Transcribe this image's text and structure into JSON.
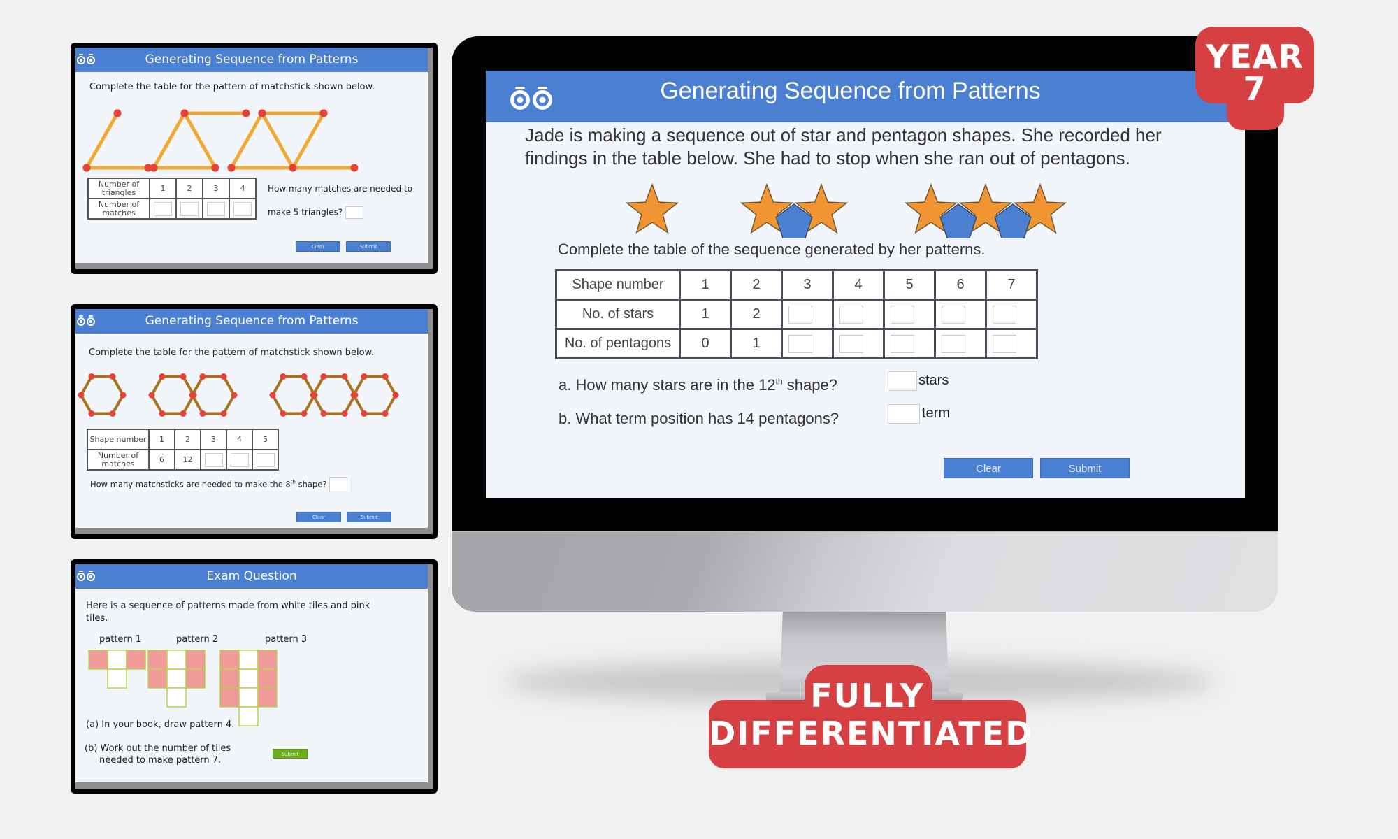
{
  "colors": {
    "background": "#f1f1f1",
    "header_blue": "#4a7fd1",
    "badge_red": "#d64043",
    "matchstick_orange": "#f0a935",
    "matchstick_brown": "#a8731f",
    "joint_red": "#e8413a",
    "star_orange": "#f19532",
    "pentagon_blue": "#4a7fd1",
    "tile_pink": "#f09a99",
    "tile_border": "#b9d24a",
    "submit_green": "#6aae1a"
  },
  "thumbnails": [
    {
      "title": "Generating Sequence from Patterns",
      "instruction": "Complete the table for the pattern of matchstick shown below.",
      "pattern_type": "triangles",
      "pattern_counts": [
        1,
        2,
        3
      ],
      "table": {
        "rows": [
          {
            "label": "Number of triangles",
            "values": [
              "1",
              "2",
              "3",
              "4"
            ]
          },
          {
            "label": "Number of matches",
            "values": [
              "",
              "",
              "",
              ""
            ]
          }
        ]
      },
      "question_line1": "How many matches are needed to",
      "question_line2": "make 5 triangles?",
      "buttons": {
        "clear": "Clear",
        "submit": "Submit"
      }
    },
    {
      "title": "Generating Sequence from Patterns",
      "instruction": "Complete the table for the pattern of matchstick shown below.",
      "pattern_type": "hexagons",
      "pattern_counts": [
        1,
        2,
        3
      ],
      "table": {
        "rows": [
          {
            "label": "Shape number",
            "values": [
              "1",
              "2",
              "3",
              "4",
              "5"
            ]
          },
          {
            "label": "Number of matches",
            "values": [
              "6",
              "12",
              "",
              "",
              ""
            ]
          }
        ]
      },
      "question": "How many matchsticks are needed to make the 8",
      "question_sup": "th",
      "question_end": " shape?",
      "buttons": {
        "clear": "Clear",
        "submit": "Submit"
      }
    },
    {
      "title": "Exam Question",
      "intro_line1": "Here is a sequence of patterns made from white tiles and pink",
      "intro_line2": "tiles.",
      "patterns": [
        {
          "label": "pattern 1",
          "rows": 1
        },
        {
          "label": "pattern 2",
          "rows": 2
        },
        {
          "label": "pattern 3",
          "rows": 3
        }
      ],
      "part_a": "(a) In your book, draw pattern 4.",
      "part_b_line1": "(b) Work out the number of tiles",
      "part_b_line2": "needed to make pattern 7.",
      "buttons": {
        "submit": "Submit"
      }
    }
  ],
  "main_screen": {
    "title": "Generating Sequence from Patterns",
    "prompt": "Jade is making a sequence out of star and pentagon shapes. She recorded her findings in the table below. She had to stop when she ran out of pentagons.",
    "patterns": [
      {
        "stars": 1,
        "pentagons": 0
      },
      {
        "stars": 2,
        "pentagons": 1
      },
      {
        "stars": 3,
        "pentagons": 2
      }
    ],
    "table_instruction": "Complete the table of the sequence generated by her patterns.",
    "table": {
      "rows": [
        {
          "label": "Shape number",
          "values": [
            "1",
            "2",
            "3",
            "4",
            "5",
            "6",
            "7"
          ],
          "inputs_from": 99
        },
        {
          "label": "No. of stars",
          "values": [
            "1",
            "2",
            "",
            "",
            "",
            "",
            ""
          ],
          "inputs_from": 2
        },
        {
          "label": "No. of pentagons",
          "values": [
            "0",
            "1",
            "",
            "",
            "",
            "",
            ""
          ],
          "inputs_from": 2
        }
      ]
    },
    "question_a": {
      "prefix": "a.  How many stars are in the 12",
      "sup": "th",
      "suffix": " shape?",
      "unit": "stars",
      "value": ""
    },
    "question_b": {
      "text": "b.  What term position has 14 pentagons?",
      "unit": "term",
      "value": ""
    },
    "buttons": {
      "clear": "Clear",
      "submit": "Submit"
    }
  },
  "badges": {
    "year_line1": "YEAR",
    "year_line2": "7",
    "diff_line1": "FULLY",
    "diff_line2": "DIFFERENTIATED"
  }
}
